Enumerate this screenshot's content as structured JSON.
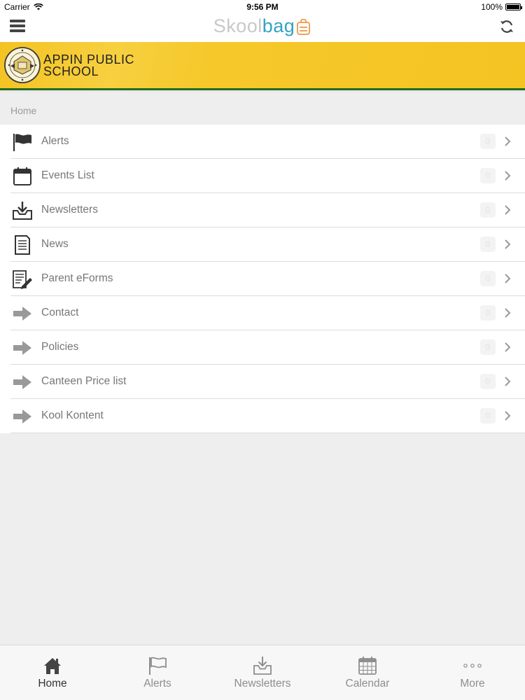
{
  "status_bar": {
    "carrier": "Carrier",
    "time": "9:56 PM",
    "battery": "100%"
  },
  "nav": {
    "brand_part1": "Skool",
    "brand_part2": "bag",
    "brand_colors": {
      "part1": "#c8c8c8",
      "part2": "#33a3c4",
      "icon": "#f0a35a"
    }
  },
  "school": {
    "name_line1": "APPIN PUBLIC",
    "name_line2": "SCHOOL",
    "banner_color": "#f4c423",
    "stripe_color": "#256b1f"
  },
  "breadcrumb": "Home",
  "menu": {
    "items": [
      {
        "label": "Alerts",
        "icon": "flag-icon",
        "count": "0"
      },
      {
        "label": "Events List",
        "icon": "calendar-icon",
        "count": "0"
      },
      {
        "label": "Newsletters",
        "icon": "inbox-download-icon",
        "count": "0"
      },
      {
        "label": "News",
        "icon": "document-icon",
        "count": "0"
      },
      {
        "label": "Parent eForms",
        "icon": "form-edit-icon",
        "count": "0"
      },
      {
        "label": "Contact",
        "icon": "arrow-right-icon",
        "count": "0"
      },
      {
        "label": "Policies",
        "icon": "arrow-right-icon",
        "count": "0"
      },
      {
        "label": "Canteen Price list",
        "icon": "arrow-right-icon",
        "count": "0"
      },
      {
        "label": "Kool Kontent",
        "icon": "arrow-right-icon",
        "count": "0"
      }
    ]
  },
  "tab_bar": {
    "active": "Home",
    "tabs": [
      {
        "label": "Home",
        "icon": "home-icon"
      },
      {
        "label": "Alerts",
        "icon": "flag-icon"
      },
      {
        "label": "Newsletters",
        "icon": "inbox-download-icon"
      },
      {
        "label": "Calendar",
        "icon": "calendar-grid-icon"
      },
      {
        "label": "More",
        "icon": "more-dots-icon"
      }
    ]
  }
}
